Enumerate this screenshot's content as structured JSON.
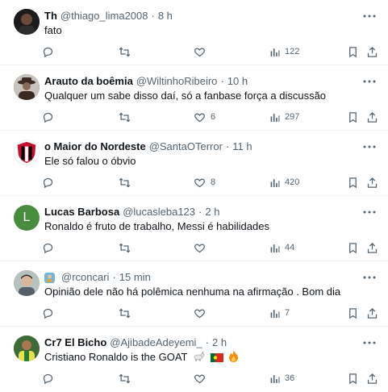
{
  "tweets": [
    {
      "name": "Th",
      "handle": "@thiago_lima2008",
      "separator": "·",
      "time": "8 h",
      "text": "fato",
      "avatar_icon": "profile-photo",
      "avatar_color": "#1c1c1c",
      "replies": "",
      "retweets": "",
      "likes": "",
      "views": "122"
    },
    {
      "name": "Arauto da boêmia",
      "handle": "@WiltinhoRibeiro",
      "separator": "·",
      "time": "10 h",
      "text": "Qualquer um sabe disso daí, só a fanbase força a discussão",
      "avatar_icon": "profile-photo",
      "avatar_color": "#3b2a24",
      "replies": "",
      "retweets": "",
      "likes": "6",
      "views": "297"
    },
    {
      "name": "o Maior do Nordeste",
      "handle": "@SantaOTerror",
      "separator": "·",
      "time": "11 h",
      "text": "Ele só falou o óbvio",
      "avatar_icon": "club-crest",
      "avatar_color": "#c8102e",
      "replies": "",
      "retweets": "",
      "likes": "8",
      "views": "420"
    },
    {
      "name": "Lucas Barbosa",
      "handle": "@lucasleba123",
      "separator": "·",
      "time": "2 h",
      "text": "Ronaldo é fruto de trabalho, Messi é habilidades",
      "avatar_icon": "letter-avatar",
      "avatar_letter": "L",
      "avatar_color": "#4a8c3f",
      "replies": "",
      "retweets": "",
      "likes": "",
      "views": "44"
    },
    {
      "name": "",
      "handle": "@rconcari",
      "separator": "·",
      "time": "15 min",
      "text": "Opinião dele não há polêmica nenhuma na afirmação . Bom dia",
      "avatar_icon": "profile-photo",
      "avatar_color": "#9aa7a3",
      "name_emoji_icon": "emoji-badge",
      "replies": "",
      "retweets": "",
      "likes": "",
      "views": "7"
    },
    {
      "name": "Cr7 El Bicho",
      "handle": "@AjibadeAdeyemi_",
      "separator": "·",
      "time": "2 h",
      "text": "Cristiano Ronaldo is the GOAT",
      "text_emojis": [
        "goat-emoji",
        "portugal-flag-emoji",
        "fire-emoji"
      ],
      "avatar_icon": "profile-photo",
      "avatar_color": "#2f5d2a",
      "replies": "",
      "retweets": "",
      "likes": "",
      "views": "36"
    }
  ],
  "colors": {
    "text_primary": "#0f1419",
    "text_secondary": "#536471",
    "divider": "#eff3f4"
  }
}
